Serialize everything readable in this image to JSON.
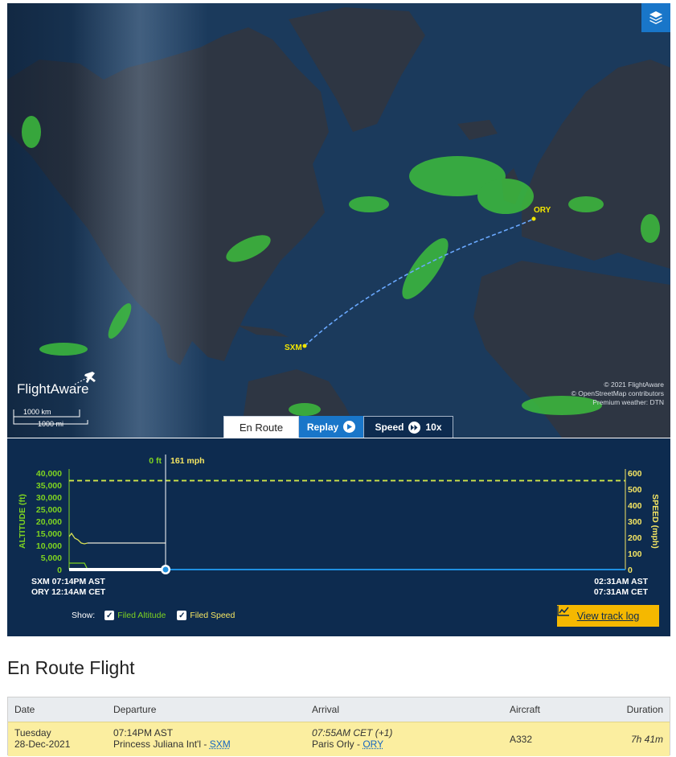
{
  "map": {
    "layers_icon": "layers-icon",
    "origin_code": "SXM",
    "destination_code": "ORY",
    "logo_text": "FlightAware",
    "scale_km": "1000 km",
    "scale_mi": "1000 mi",
    "credits": [
      "© 2021 FlightAware",
      "© OpenStreetMap contributors",
      "Premium weather: DTN"
    ],
    "colors": {
      "ocean": "#1b3a5c",
      "land": "#2c3340",
      "weather": "#3dbd3d",
      "route": "#6aa9ff",
      "label": "#f2e600"
    }
  },
  "tabs": {
    "en_route": "En Route",
    "replay": "Replay",
    "speed_label": "Speed",
    "speed_value": "10x"
  },
  "chart": {
    "cursor_alt": "0 ft",
    "cursor_speed": "161 mph",
    "left_axis_title": "ALTITUDE (ft)",
    "right_axis_title": "SPEED (mph)",
    "left_ticks": [
      "40,000",
      "35,000",
      "30,000",
      "25,000",
      "20,000",
      "15,000",
      "10,000",
      "5,000",
      "0"
    ],
    "right_ticks": [
      "600",
      "500",
      "400",
      "300",
      "200",
      "100",
      "0"
    ],
    "start_time_origin": "SXM 07:14PM AST",
    "start_time_dest": "ORY 12:14AM CET",
    "end_time_origin": "02:31AM AST",
    "end_time_dest": "07:31AM CET",
    "show_label": "Show:",
    "filed_altitude_label": "Filed Altitude",
    "filed_speed_label": "Filed Speed",
    "track_log_label": "View track log",
    "filed_altitude_ft": 37000,
    "filed_speed_mph": 551,
    "progress_fraction": 0.16,
    "colors": {
      "altitude": "#7ed321",
      "speed": "#f5e663",
      "accent": "#f5b800"
    }
  },
  "chart_data": {
    "type": "line",
    "series": [
      {
        "name": "Filed Altitude",
        "values": [
          37000
        ]
      },
      {
        "name": "Filed Speed",
        "values": [
          551
        ]
      }
    ],
    "ylabel": "ALTITUDE (ft)",
    "y2label": "SPEED (mph)",
    "ylim": [
      0,
      40000
    ],
    "y2lim": [
      0,
      600
    ]
  },
  "section_title": "En Route Flight",
  "table": {
    "headers": [
      "Date",
      "Departure",
      "Arrival",
      "Aircraft",
      "Duration"
    ],
    "date_day": "Tuesday",
    "date": "28-Dec-2021",
    "dep_time": "07:14PM AST",
    "dep_airport": "Princess Juliana Int'l",
    "dep_code": "SXM",
    "arr_time": "07:55AM CET (+1)",
    "arr_airport": "Paris Orly",
    "arr_code": "ORY",
    "aircraft": "A332",
    "duration": "7h 41m",
    "separator": " - "
  }
}
